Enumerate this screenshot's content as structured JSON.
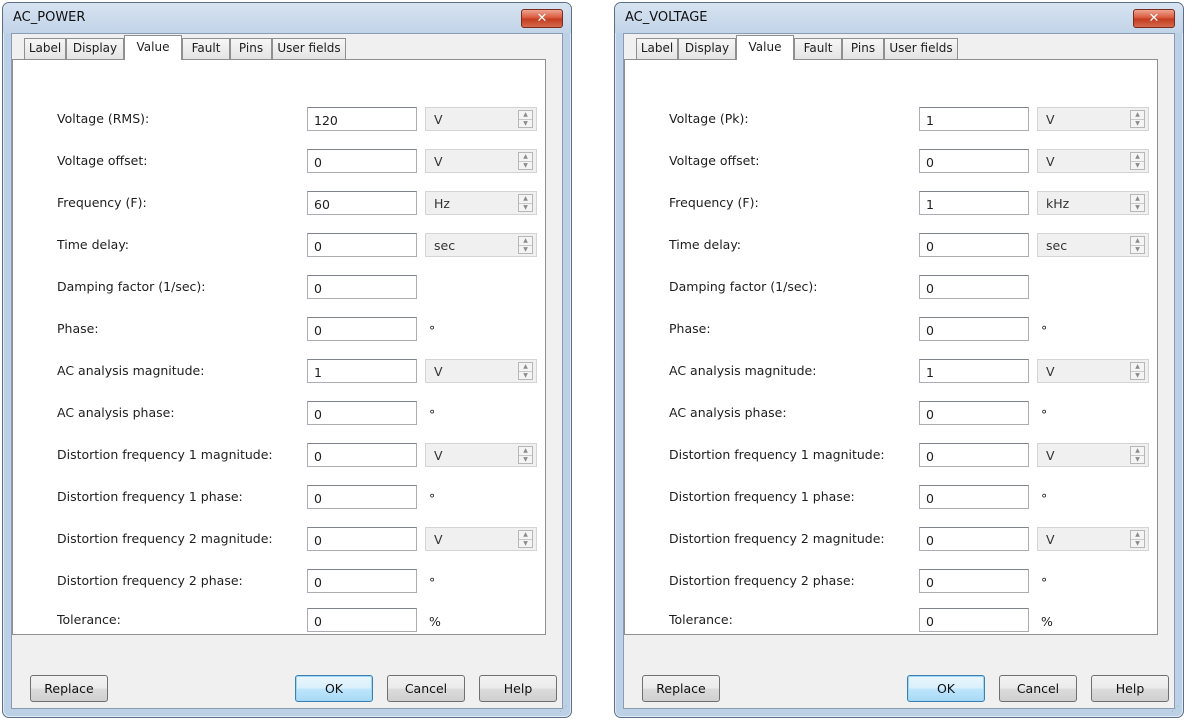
{
  "common": {
    "tabs": [
      "Label",
      "Display",
      "Value",
      "Fault",
      "Pins",
      "User fields"
    ],
    "buttons": {
      "replace": "Replace",
      "ok": "OK",
      "cancel": "Cancel",
      "help": "Help"
    },
    "degree_symbol": "°",
    "percent": "%"
  },
  "dialogs": [
    {
      "title": "AC_POWER",
      "rows": {
        "voltage": {
          "label": "Voltage (RMS):",
          "value": "120",
          "unit": "V"
        },
        "voltage_offset": {
          "label": "Voltage offset:",
          "value": "0",
          "unit": "V"
        },
        "frequency": {
          "label": "Frequency (F):",
          "value": "60",
          "unit": "Hz"
        },
        "time_delay": {
          "label": "Time delay:",
          "value": "0",
          "unit": "sec"
        },
        "damping": {
          "label": "Damping factor (1/sec):",
          "value": "0"
        },
        "phase": {
          "label": "Phase:",
          "value": "0"
        },
        "ac_mag": {
          "label": "AC analysis magnitude:",
          "value": "1",
          "unit": "V"
        },
        "ac_phase": {
          "label": "AC analysis phase:",
          "value": "0"
        },
        "dist1_mag": {
          "label": "Distortion frequency 1 magnitude:",
          "value": "0",
          "unit": "V"
        },
        "dist1_phase": {
          "label": "Distortion frequency 1 phase:",
          "value": "0"
        },
        "dist2_mag": {
          "label": "Distortion frequency 2 magnitude:",
          "value": "0",
          "unit": "V"
        },
        "dist2_phase": {
          "label": "Distortion frequency 2 phase:",
          "value": "0"
        },
        "tolerance": {
          "label": "Tolerance:",
          "value": "0"
        }
      }
    },
    {
      "title": "AC_VOLTAGE",
      "rows": {
        "voltage": {
          "label": "Voltage (Pk):",
          "value": "1",
          "unit": "V"
        },
        "voltage_offset": {
          "label": "Voltage offset:",
          "value": "0",
          "unit": "V"
        },
        "frequency": {
          "label": "Frequency (F):",
          "value": "1",
          "unit": "kHz"
        },
        "time_delay": {
          "label": "Time delay:",
          "value": "0",
          "unit": "sec"
        },
        "damping": {
          "label": "Damping factor (1/sec):",
          "value": "0"
        },
        "phase": {
          "label": "Phase:",
          "value": "0"
        },
        "ac_mag": {
          "label": "AC analysis magnitude:",
          "value": "1",
          "unit": "V"
        },
        "ac_phase": {
          "label": "AC analysis phase:",
          "value": "0"
        },
        "dist1_mag": {
          "label": "Distortion frequency 1 magnitude:",
          "value": "0",
          "unit": "V"
        },
        "dist1_phase": {
          "label": "Distortion frequency 1 phase:",
          "value": "0"
        },
        "dist2_mag": {
          "label": "Distortion frequency 2 magnitude:",
          "value": "0",
          "unit": "V"
        },
        "dist2_phase": {
          "label": "Distortion frequency 2 phase:",
          "value": "0"
        },
        "tolerance": {
          "label": "Tolerance:",
          "value": "0"
        }
      }
    }
  ]
}
